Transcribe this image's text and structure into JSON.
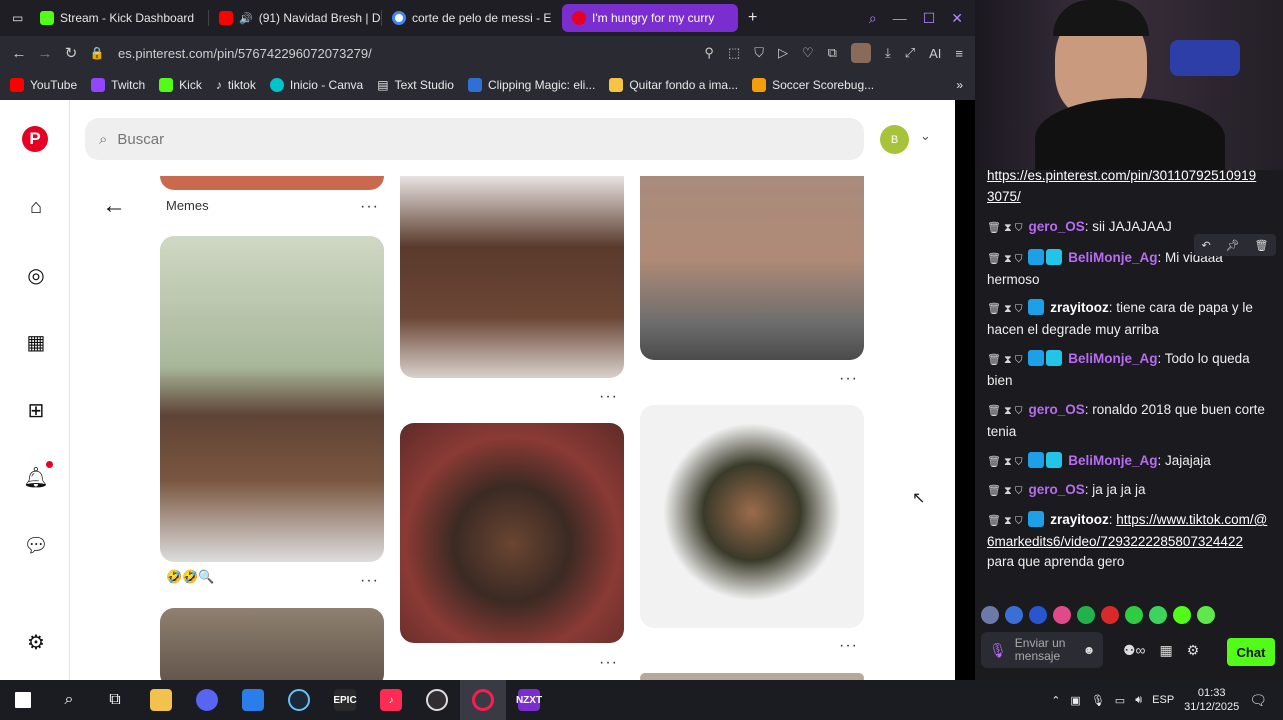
{
  "browser": {
    "tabs": [
      {
        "label": "Stream - Kick Dashboard",
        "color": "#53fc18"
      },
      {
        "label": "(91) Navidad Bresh | D",
        "color": "#ff0000"
      },
      {
        "label": "corte de pelo de messi - E",
        "color": "#4285f4"
      },
      {
        "label": "I'm hungry for my curry",
        "color": "#e60023"
      }
    ],
    "new_tab": "+",
    "url": "es.pinterest.com/pin/576742296072073279/",
    "ai_label": "AI",
    "bookmarks": [
      {
        "label": "YouTube",
        "color": "#ff0000"
      },
      {
        "label": "Twitch",
        "color": "#9146ff"
      },
      {
        "label": "Kick",
        "color": "#53fc18"
      },
      {
        "label": "tiktok",
        "color": "#111111"
      },
      {
        "label": "Inicio - Canva",
        "color": "#00c4cc"
      },
      {
        "label": "Text Studio",
        "color": "#ffffff"
      },
      {
        "label": "Clipping Magic: eli...",
        "color": "#2f6fd6"
      },
      {
        "label": "Quitar fondo a ima...",
        "color": "#f6c443"
      },
      {
        "label": "Soccer Scorebug...",
        "color": "#f59e0b"
      }
    ]
  },
  "pinterest": {
    "search_placeholder": "Buscar",
    "user_initial": "B",
    "board_label": "Memes",
    "emoji_caption": "🤣🤣🔍",
    "more": "···"
  },
  "chat": {
    "messages": [
      {
        "user": "",
        "text": "https://es.pinterest.com/pin/30110792510919 3075/"
      },
      {
        "user": "gero_OS",
        "text": "sii JAJAJAAJ"
      },
      {
        "user": "BeliMonje_Ag",
        "text": "Mi vidaaa hermoso"
      },
      {
        "user": "zrayitooz",
        "text": "tiene cara de papa y le hacen el degrade muy arriba"
      },
      {
        "user": "BeliMonje_Ag",
        "text": "Todo lo queda bien"
      },
      {
        "user": "gero_OS",
        "text": "ronaldo 2018 que buen corte tenia"
      },
      {
        "user": "BeliMonje_Ag",
        "text": "Jajajaja"
      },
      {
        "user": "gero_OS",
        "text": "ja ja ja ja"
      },
      {
        "user": "zrayitooz",
        "link": "https://www.tiktok.com/@6markedits6/video/7293222285807324422",
        "text": "para que aprenda gero"
      }
    ],
    "input_placeholder": "Enviar un mensaje",
    "chat_button": "Chat"
  },
  "taskbar": {
    "apps": [
      "windows-start",
      "search",
      "task-view",
      "file-explorer",
      "discord",
      "microsoft-store",
      "steam",
      "epic-games",
      "tiktok-live",
      "obs",
      "opera-gx",
      "nzxt"
    ],
    "lang": "ESP",
    "time": "01:33",
    "date": "31/12/2025"
  }
}
